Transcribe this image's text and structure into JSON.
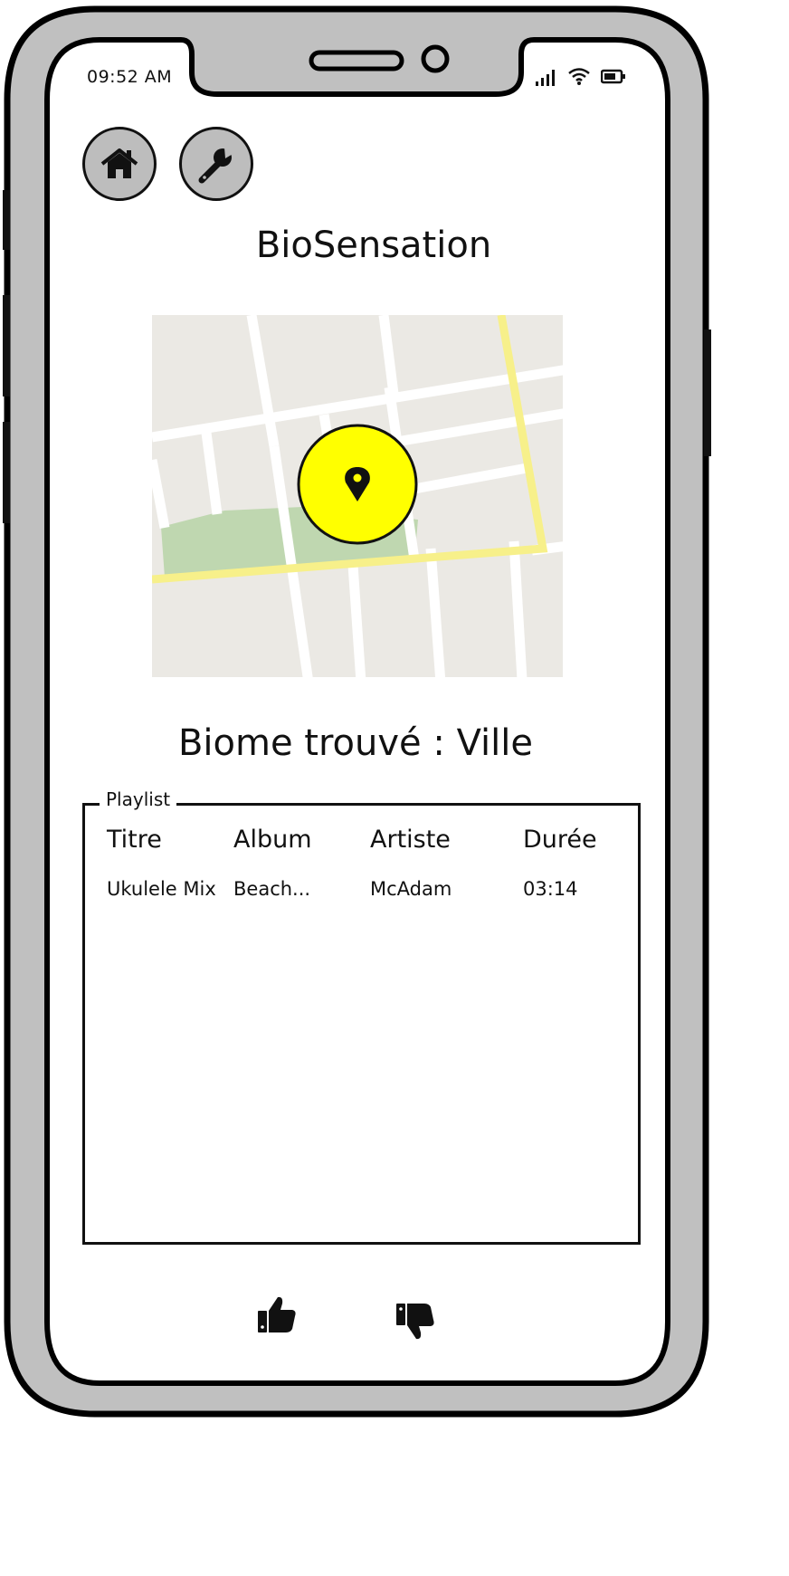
{
  "status_bar": {
    "time": "09:52 AM",
    "icons": [
      "signal-icon",
      "wifi-icon",
      "battery-icon"
    ]
  },
  "toolbar": {
    "buttons": [
      {
        "name": "home-button",
        "icon": "home-icon"
      },
      {
        "name": "settings-button",
        "icon": "wrench-icon"
      }
    ]
  },
  "app": {
    "title": "BioSensation"
  },
  "map": {
    "marker_icon": "location-pin-icon",
    "marker_color": "#ffff00"
  },
  "biome": {
    "text": "Biome trouvé : Ville"
  },
  "playlist": {
    "legend": "Playlist",
    "columns": [
      "Titre",
      "Album",
      "Artiste",
      "Durée"
    ],
    "rows": [
      {
        "title": "Ukulele Mix",
        "album": "Beach...",
        "artist": "McAdam",
        "duration": "03:14"
      }
    ]
  },
  "feedback": {
    "icons": [
      "thumbs-up-icon",
      "thumbs-down-icon"
    ]
  },
  "colors": {
    "device_frame": "#c0c0c0",
    "map_background": "#ebe9e4",
    "map_park": "#bfd7b0",
    "map_main_road": "#f7f08a"
  }
}
